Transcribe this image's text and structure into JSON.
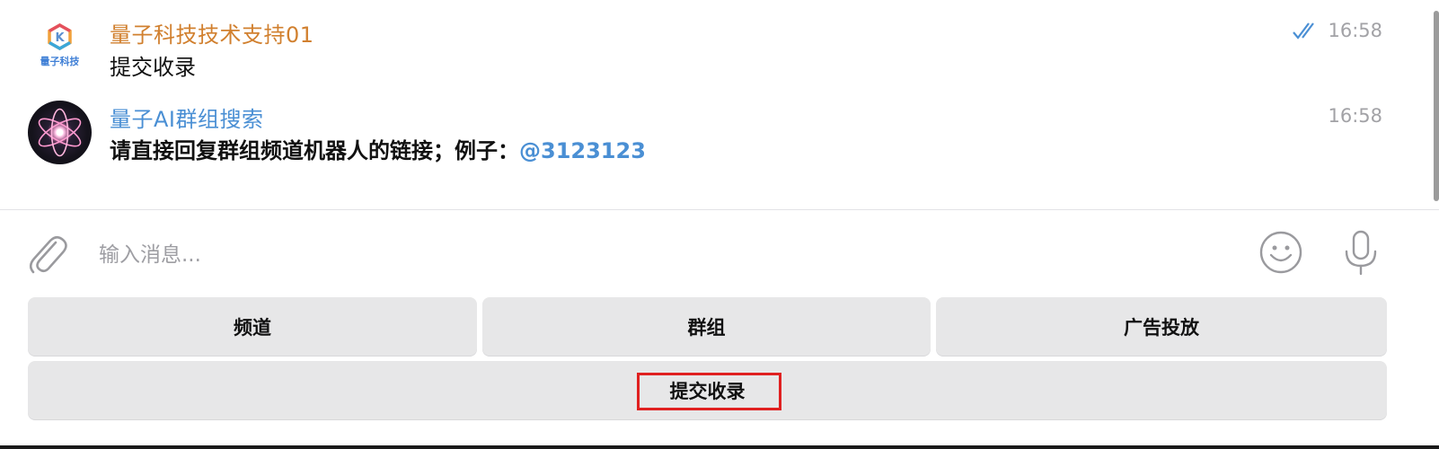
{
  "messages": [
    {
      "sender": "量子科技技术支持01",
      "sender_color": "#d1802f",
      "text": "提交收录",
      "time": "16:58",
      "read": true,
      "avatar_text": "量子科技",
      "avatar_badge": "K"
    },
    {
      "sender": "量子AI群组搜索",
      "sender_color": "#4a8fd4",
      "text": "请直接回复群组频道机器人的链接；例子：",
      "mention": "@3123123",
      "time": "16:58"
    }
  ],
  "composer": {
    "placeholder": "输入消息..."
  },
  "keyboard": {
    "row1": [
      "频道",
      "群组",
      "广告投放"
    ],
    "row2": [
      "提交收录"
    ]
  },
  "icons": {
    "attach": "paperclip-icon",
    "emoji": "emoji-icon",
    "mic": "microphone-icon",
    "read": "double-check-icon"
  },
  "colors": {
    "accent": "#4a8fd4",
    "highlight": "#e02020"
  }
}
